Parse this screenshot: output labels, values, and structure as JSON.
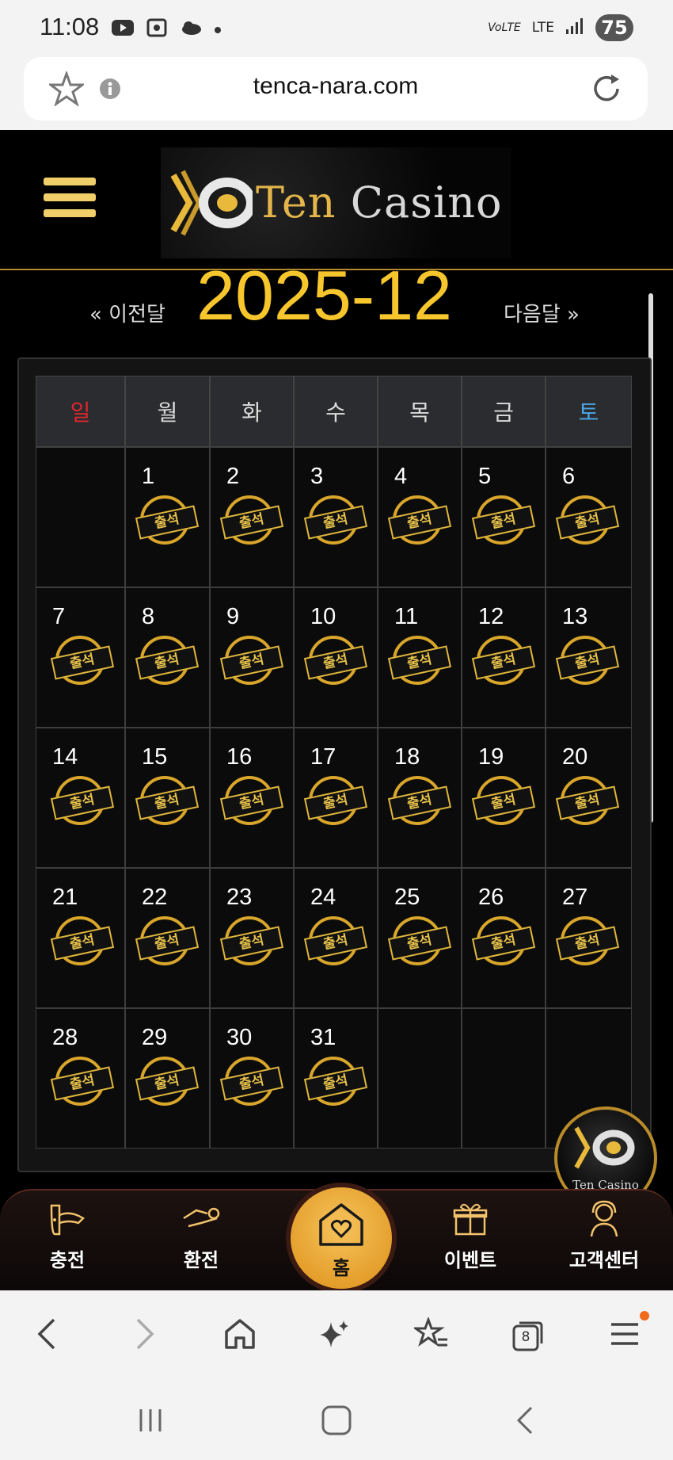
{
  "status_bar": {
    "time": "11:08",
    "network": "LTE",
    "battery": "75"
  },
  "browser": {
    "url": "tenca-nara.com",
    "tab_count": "8"
  },
  "site": {
    "logo_text_1": "Ten",
    "logo_text_2": "Casino",
    "floater_text": "Ten Casino"
  },
  "calendar": {
    "prev_label": "« 이전달",
    "next_label": "다음달 »",
    "month_label": "2025-12",
    "weekdays": [
      "일",
      "월",
      "화",
      "수",
      "목",
      "금",
      "토"
    ],
    "weekday_colors": {
      "sun": "#e0262e",
      "sat": "#4aa8e8",
      "other": "#dddddd"
    },
    "stamp_text": "출석",
    "weeks": [
      [
        "",
        "1",
        "2",
        "3",
        "4",
        "5",
        "6"
      ],
      [
        "7",
        "8",
        "9",
        "10",
        "11",
        "12",
        "13"
      ],
      [
        "14",
        "15",
        "16",
        "17",
        "18",
        "19",
        "20"
      ],
      [
        "21",
        "22",
        "23",
        "24",
        "25",
        "26",
        "27"
      ],
      [
        "28",
        "29",
        "30",
        "31",
        "",
        "",
        ""
      ]
    ]
  },
  "bottom_nav": {
    "charge": "충전",
    "exchange": "환전",
    "home": "홈",
    "event": "이벤트",
    "support": "고객센터"
  },
  "colors": {
    "accent_gold": "#f6c62c",
    "stamp_gold": "#d9a62b"
  }
}
